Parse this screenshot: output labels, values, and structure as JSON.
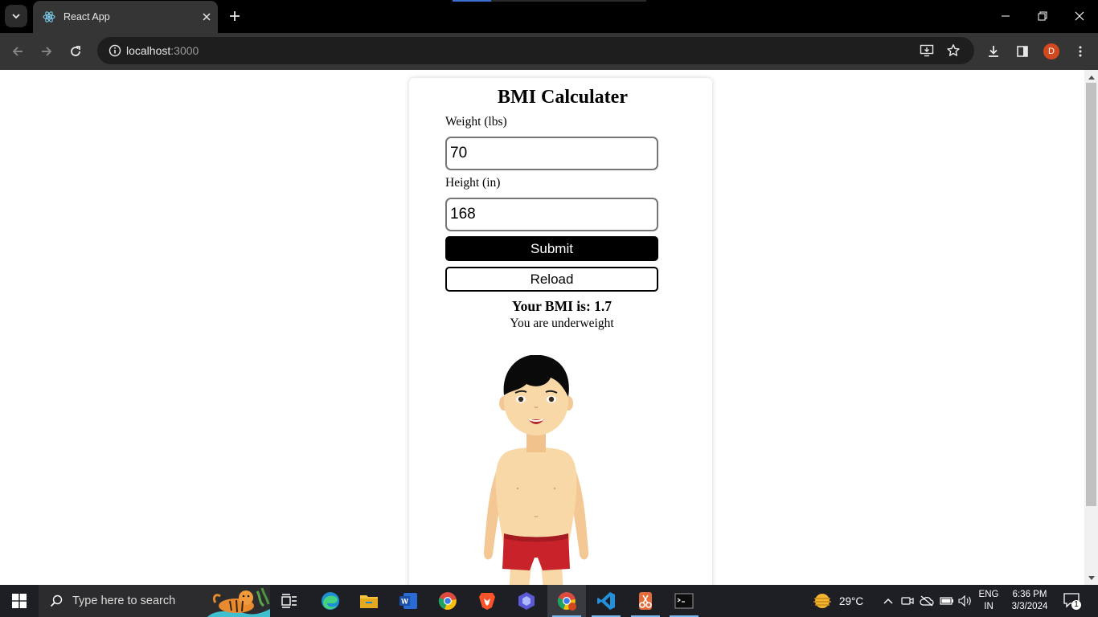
{
  "browser": {
    "tab": {
      "title": "React App"
    },
    "url": {
      "host": "localhost",
      "port": ":3000"
    },
    "profile_initial": "D"
  },
  "app": {
    "title": "BMI Calculater",
    "weight": {
      "label": "Weight (lbs)",
      "value": "70"
    },
    "height": {
      "label": "Height (in)",
      "value": "168"
    },
    "submit_label": "Submit",
    "reload_label": "Reload",
    "result": "Your BMI is: 1.7",
    "status": "You are underweight"
  },
  "taskbar": {
    "search_placeholder": "Type here to search",
    "weather_temp": "29°C",
    "lang_line1": "ENG",
    "lang_line2": "IN",
    "time": "6:36 PM",
    "date": "3/3/2024",
    "notification_count": "1"
  },
  "colors": {
    "chrome_bg": "#000000",
    "toolbar_bg": "#353535",
    "submit_bg": "#000000",
    "shorts": "#c8232a",
    "skin": "#f9d8a8"
  }
}
